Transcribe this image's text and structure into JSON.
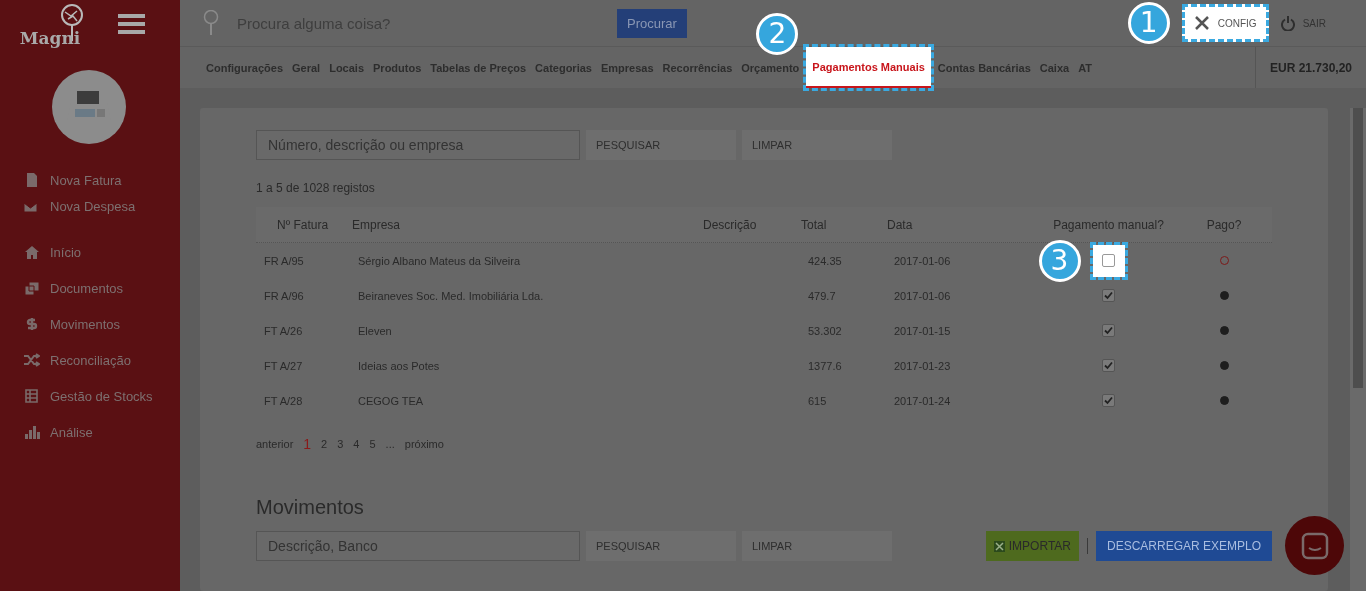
{
  "logo": {
    "text": "Magni"
  },
  "search": {
    "placeholder": "Procura alguma coisa?",
    "button": "Procurar"
  },
  "header_actions": [
    {
      "kind": "config",
      "label": "CONFIG",
      "highlighted": true,
      "callout": "1"
    },
    {
      "kind": "power",
      "label": "SAIR",
      "highlighted": false
    }
  ],
  "sidebar": {
    "quick_actions": [
      {
        "kind": "file",
        "label": "Nova Fatura"
      },
      {
        "kind": "mail",
        "label": "Nova Despesa"
      }
    ],
    "items": [
      {
        "kind": "home",
        "label": "Início"
      },
      {
        "kind": "docs",
        "label": "Documentos"
      },
      {
        "kind": "dollar",
        "label": "Movimentos"
      },
      {
        "kind": "shuffle",
        "label": "Reconciliação"
      },
      {
        "kind": "stock",
        "label": "Gestão de Stocks"
      },
      {
        "kind": "chart",
        "label": "Análise"
      }
    ]
  },
  "tabs": [
    {
      "label": "Configurações",
      "selected": false,
      "highlighted": false
    },
    {
      "label": "Geral",
      "selected": false,
      "highlighted": false
    },
    {
      "label": "Locais",
      "selected": false,
      "highlighted": false
    },
    {
      "label": "Produtos",
      "selected": false,
      "highlighted": false
    },
    {
      "label": "Tabelas de Preços",
      "selected": false,
      "highlighted": false
    },
    {
      "label": "Categorias",
      "selected": false,
      "highlighted": false
    },
    {
      "label": "Empresas",
      "selected": false,
      "highlighted": false
    },
    {
      "label": "Recorrências",
      "selected": false,
      "highlighted": false
    },
    {
      "label": "Orçamento",
      "selected": false,
      "highlighted": false
    },
    {
      "label": "Pagamentos Manuais",
      "selected": true,
      "highlighted": true,
      "callout": "2"
    },
    {
      "label": "Contas Bancárias",
      "selected": false,
      "highlighted": false
    },
    {
      "label": "Caixa",
      "selected": false,
      "highlighted": false
    },
    {
      "label": "AT",
      "selected": false,
      "highlighted": false
    }
  ],
  "balance": "EUR 21.730,20",
  "invoices": {
    "search_placeholder": "Número, descrição ou empresa",
    "search_button": "PESQUISAR",
    "clear_button": "LIMPAR",
    "count": "1 a 5 de 1028 registos",
    "columns": [
      "Nº Fatura",
      "Empresa",
      "Descrição",
      "Total",
      "Data",
      "Pagamento manual?",
      "Pago?"
    ],
    "rows": [
      {
        "number": "FR A/95",
        "company": "Sérgio Albano Mateus da Silveira",
        "total": "424.35",
        "date": "2017-01-06",
        "manual": false,
        "paid": false,
        "highlighted": true,
        "callout": "3"
      },
      {
        "number": "FR A/96",
        "company": "Beiraneves Soc. Med. Imobiliária Lda.",
        "total": "479.7",
        "date": "2017-01-06",
        "manual": true,
        "paid": true,
        "highlighted": false
      },
      {
        "number": "FT A/26",
        "company": "Eleven",
        "total": "53.302",
        "date": "2017-01-15",
        "manual": true,
        "paid": true,
        "highlighted": false
      },
      {
        "number": "FT A/27",
        "company": "Ideias aos Potes",
        "total": "1377.6",
        "date": "2017-01-23",
        "manual": true,
        "paid": true,
        "highlighted": false
      },
      {
        "number": "FT A/28",
        "company": "CEGOG TEA",
        "total": "615",
        "date": "2017-01-24",
        "manual": true,
        "paid": true,
        "highlighted": false
      }
    ],
    "pagination": {
      "previous": "anterior",
      "pages": [
        {
          "label": "1",
          "selected": true
        },
        {
          "label": "2",
          "selected": false
        },
        {
          "label": "3",
          "selected": false
        },
        {
          "label": "4",
          "selected": false
        },
        {
          "label": "5",
          "selected": false
        }
      ],
      "ellipsis": "...",
      "next": "próximo"
    }
  },
  "movements": {
    "title": "Movimentos",
    "search_placeholder": "Descrição, Banco",
    "search_button": "PESQUISAR",
    "clear_button": "LIMPAR",
    "import_button": "IMPORTAR",
    "download_button": "DESCARREGAR EXEMPLO"
  }
}
